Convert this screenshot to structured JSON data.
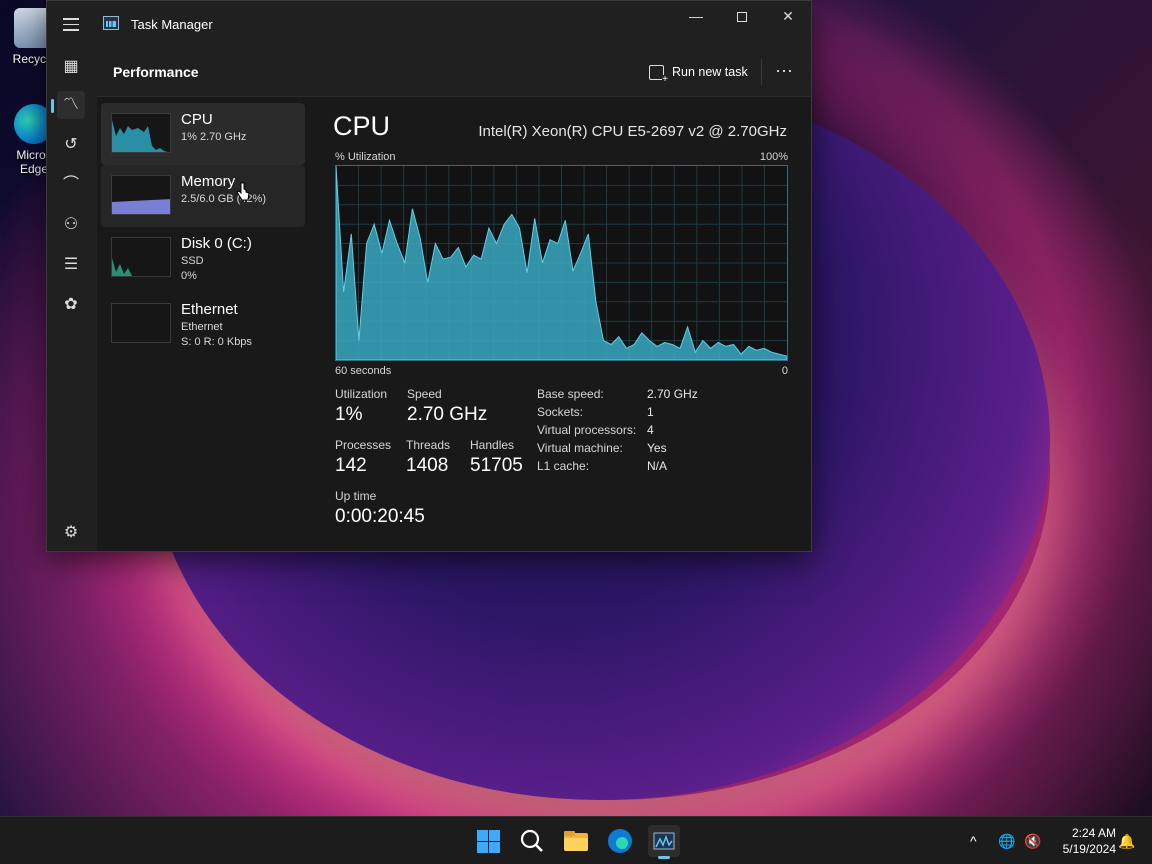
{
  "desktop": {
    "icons": [
      {
        "label": "Recycle"
      },
      {
        "label": "Micros\nEdge"
      }
    ]
  },
  "window": {
    "title": "Task Manager",
    "page_title": "Performance",
    "run_new_task": "Run new task",
    "more": "⋯"
  },
  "perf_items": [
    {
      "name": "CPU",
      "sub1": "1%  2.70 GHz",
      "sub2": ""
    },
    {
      "name": "Memory",
      "sub1": "2.5/6.0 GB (42%)",
      "sub2": ""
    },
    {
      "name": "Disk 0 (C:)",
      "sub1": "SSD",
      "sub2": "0%"
    },
    {
      "name": "Ethernet",
      "sub1": "Ethernet",
      "sub2": "S: 0 R: 0 Kbps"
    }
  ],
  "cpu": {
    "title": "CPU",
    "model": "Intel(R) Xeon(R) CPU E5-2697 v2 @ 2.70GHz",
    "util_label": "% Utilization",
    "util_max": "100%",
    "time_left": "60 seconds",
    "time_right": "0",
    "stats": {
      "utilization_label": "Utilization",
      "utilization": "1%",
      "speed_label": "Speed",
      "speed": "2.70 GHz",
      "processes_label": "Processes",
      "processes": "142",
      "threads_label": "Threads",
      "threads": "1408",
      "handles_label": "Handles",
      "handles": "51705",
      "uptime_label": "Up time",
      "uptime": "0:00:20:45"
    },
    "specs": [
      {
        "k": "Base speed:",
        "v": "2.70 GHz"
      },
      {
        "k": "Sockets:",
        "v": "1"
      },
      {
        "k": "Virtual processors:",
        "v": "4"
      },
      {
        "k": "Virtual machine:",
        "v": "Yes"
      },
      {
        "k": "L1 cache:",
        "v": "N/A"
      }
    ]
  },
  "chart_data": {
    "type": "area",
    "title": "",
    "xlabel": "",
    "ylabel": "% Utilization",
    "ylim": [
      0,
      100
    ],
    "x_tick_labels": [
      "60 seconds",
      "0"
    ],
    "y_tick_labels": [
      "100%"
    ],
    "series": [
      {
        "values": [
          100,
          35,
          65,
          10,
          60,
          70,
          55,
          72,
          60,
          50,
          78,
          63,
          40,
          60,
          52,
          53,
          58,
          48,
          54,
          52,
          68,
          60,
          70,
          75,
          68,
          45,
          73,
          50,
          62,
          60,
          72,
          46,
          55,
          65,
          30,
          10,
          8,
          12,
          6,
          8,
          14,
          10,
          7,
          9,
          8,
          6,
          17,
          4,
          10,
          6,
          9,
          7,
          8,
          3,
          7,
          5,
          6,
          4,
          3,
          2
        ]
      }
    ],
    "color": "#3aa9c2",
    "grid": true
  },
  "taskbar": {
    "time": "2:24 AM",
    "date": "5/19/2024"
  }
}
